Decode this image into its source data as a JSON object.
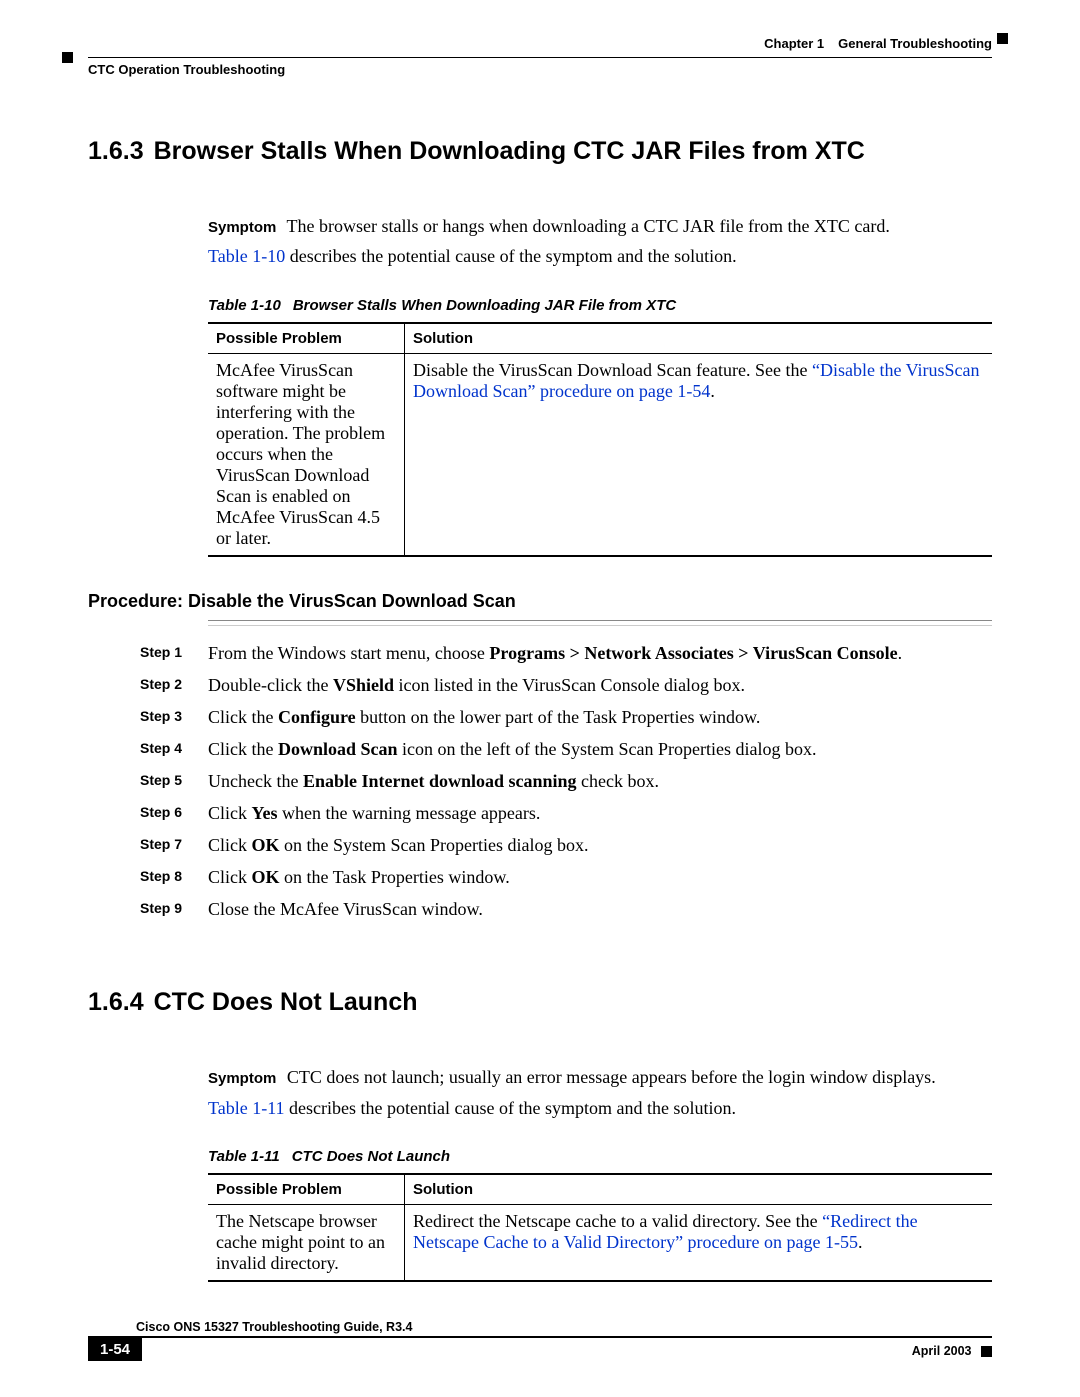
{
  "header": {
    "chapter_label": "Chapter 1",
    "chapter_title": "General Troubleshooting",
    "section_path": "CTC Operation Troubleshooting"
  },
  "section_163": {
    "number": "1.6.3",
    "title": "Browser Stalls When Downloading CTC JAR Files from XTC",
    "symptom_label": "Symptom",
    "symptom_text": "The browser stalls or hangs when downloading a CTC JAR file from the XTC card.",
    "table_ref_link": "Table 1-10",
    "table_ref_rest": " describes the potential cause of the symptom and the solution.",
    "table": {
      "caption_num": "Table 1-10",
      "caption_title": "Browser Stalls When Downloading JAR File from XTC",
      "col1": "Possible Problem",
      "col2": "Solution",
      "problem": "McAfee VirusScan software might be interfering with the operation. The problem occurs when the VirusScan Download Scan is enabled on McAfee VirusScan 4.5 or later.",
      "solution_pre": "Disable the VirusScan Download Scan feature. See the ",
      "solution_link": "“Disable the VirusScan Download Scan” procedure on page 1-54",
      "solution_post": "."
    },
    "procedure": {
      "title": "Procedure: Disable the VirusScan Download Scan",
      "steps": [
        {
          "label": "Step 1",
          "pre": "From the Windows start menu, choose ",
          "b": "Programs > Network Associates > VirusScan Console",
          "post": "."
        },
        {
          "label": "Step 2",
          "pre": "Double-click the ",
          "b": "VShield",
          "post": " icon listed in the VirusScan Console dialog box."
        },
        {
          "label": "Step 3",
          "pre": "Click the ",
          "b": "Configure",
          "post": " button on the lower part of the Task Properties window."
        },
        {
          "label": "Step 4",
          "pre": "Click the ",
          "b": "Download Scan",
          "post": " icon on the left of the System Scan Properties dialog box."
        },
        {
          "label": "Step 5",
          "pre": "Uncheck the ",
          "b": "Enable Internet download scanning",
          "post": " check box."
        },
        {
          "label": "Step 6",
          "pre": "Click ",
          "b": "Yes",
          "post": " when the warning message appears."
        },
        {
          "label": "Step 7",
          "pre": "Click ",
          "b": "OK",
          "post": " on the System Scan Properties dialog box."
        },
        {
          "label": "Step 8",
          "pre": "Click ",
          "b": "OK",
          "post": " on the Task Properties window."
        },
        {
          "label": "Step 9",
          "pre": "Close the McAfee VirusScan window.",
          "b": "",
          "post": ""
        }
      ]
    }
  },
  "section_164": {
    "number": "1.6.4",
    "title": "CTC Does Not Launch",
    "symptom_label": "Symptom",
    "symptom_text": "CTC does not launch; usually an error message appears before the login window displays.",
    "table_ref_link": "Table 1-11",
    "table_ref_rest": " describes the potential cause of the symptom and the solution.",
    "table": {
      "caption_num": "Table 1-11",
      "caption_title": "CTC Does Not Launch",
      "col1": "Possible Problem",
      "col2": "Solution",
      "problem": "The Netscape browser cache might point to an invalid directory.",
      "solution_pre": "Redirect the Netscape cache to a valid directory. See the ",
      "solution_link": "“Redirect the Netscape Cache to a Valid Directory” procedure on page 1-55",
      "solution_post": "."
    }
  },
  "footer": {
    "doc_title": "Cisco ONS 15327 Troubleshooting Guide, R3.4",
    "page_number": "1-54",
    "date": "April 2003"
  }
}
